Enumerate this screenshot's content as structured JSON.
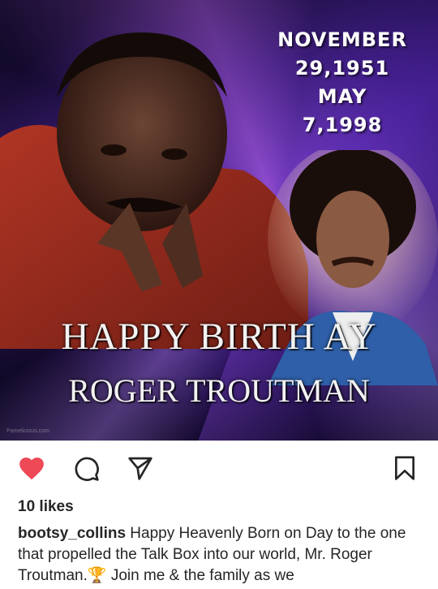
{
  "post": {
    "image": {
      "dates": {
        "line1": "NOVEMBER",
        "line2": "29,1951",
        "line3": "MAY",
        "line4": "7,1998"
      },
      "headline": "HAPPY BIRTH  AY",
      "subheadline": "ROGER TROUTMAN",
      "watermark": "Pamelicious.com"
    },
    "actions": {
      "like_icon": "heart-filled-icon",
      "comment_icon": "comment-icon",
      "share_icon": "send-icon",
      "save_icon": "bookmark-icon",
      "like_color": "#ed4956"
    },
    "likes": "10 likes",
    "caption": {
      "username": "bootsy_collins",
      "text_part1": " Happy Heavenly Born on Day to the one that propelled the Talk Box into our world, Mr. Roger Troutman.",
      "emoji": "🏆",
      "text_part2": " Join me & the family as we"
    }
  }
}
